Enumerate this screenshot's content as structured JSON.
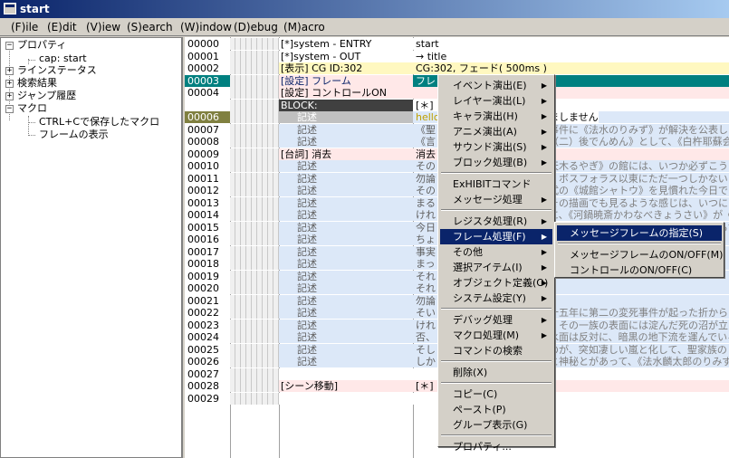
{
  "window": {
    "title": "start"
  },
  "menubar": [
    "(F)ile",
    "(E)dit",
    "(V)iew",
    "(S)earch",
    "(W)indow",
    "(D)ebug",
    "(M)acro"
  ],
  "tree": {
    "properties": "プロパティ",
    "cap": "cap: start",
    "line_status": "ラインステータス",
    "search_results": "検索結果",
    "jump_history": "ジャンプ履歴",
    "macro": "マクロ",
    "macro_items": [
      "CTRL+Cで保存したマクロ",
      "フレームの表示"
    ]
  },
  "rows": [
    {
      "num": "00000",
      "cmd": "[*]system -  ENTRY",
      "arg": "start"
    },
    {
      "num": "00001",
      "cmd": "[*]system -  OUT",
      "arg": "→ title"
    },
    {
      "num": "00002",
      "cmd": "[表示] CG ID:302",
      "arg": "CG:302, フェード( 500ms )"
    },
    {
      "num": "00003",
      "cmd": "[設定] フレーム",
      "arg": "フレ"
    },
    {
      "num": "00004",
      "cmd": "[設定] コントロールON",
      "arg": ""
    },
    {
      "num": "",
      "cmd": "BLOCK:",
      "arg": "[＊]"
    },
    {
      "num": "00006",
      "cmd": "記述",
      "arg": "hello"
    },
    {
      "num": "00007",
      "cmd": "記述",
      "arg": "《聖"
    },
    {
      "num": "00008",
      "cmd": "記述",
      "arg": "《言"
    },
    {
      "num": "00009",
      "cmd": "[台詞] 消去",
      "arg": "消去"
    },
    {
      "num": "00010",
      "cmd": "記述",
      "arg": "その"
    },
    {
      "num": "00011",
      "cmd": "記述",
      "arg": "勿論"
    },
    {
      "num": "00012",
      "cmd": "記述",
      "arg": "その"
    },
    {
      "num": "00013",
      "cmd": "記述",
      "arg": "まる"
    },
    {
      "num": "00014",
      "cmd": "記述",
      "arg": "けれ"
    },
    {
      "num": "00015",
      "cmd": "記述",
      "arg": "今日"
    },
    {
      "num": "00016",
      "cmd": "記述",
      "arg": "ちょ"
    },
    {
      "num": "00017",
      "cmd": "記述",
      "arg": "事実"
    },
    {
      "num": "00018",
      "cmd": "記述",
      "arg": "まっ"
    },
    {
      "num": "00019",
      "cmd": "記述",
      "arg": "それ"
    },
    {
      "num": "00020",
      "cmd": "記述",
      "arg": "それ"
    },
    {
      "num": "00021",
      "cmd": "記述",
      "arg": "勿論"
    },
    {
      "num": "00022",
      "cmd": "記述",
      "arg": "そい"
    },
    {
      "num": "00023",
      "cmd": "記述",
      "arg": "けれ"
    },
    {
      "num": "00024",
      "cmd": "記述",
      "arg": "否、"
    },
    {
      "num": "00025",
      "cmd": "記述",
      "arg": "そし"
    },
    {
      "num": "00026",
      "cmd": "記述",
      "arg": "しか"
    },
    {
      "num": "00027",
      "cmd": "",
      "arg": ""
    },
    {
      "num": "00028",
      "cmd": "[シーン移動]",
      "arg": "[＊]"
    },
    {
      "num": "00029",
      "cmd": "",
      "arg": ""
    }
  ],
  "right_text": [
    {
      "row": 6,
      "text": "ましません"
    },
    {
      "row": 7,
      "text": "事件に《法水のりみず》が解決を公表し"
    },
    {
      "row": 8,
      "text": "（二）後でんめん》として、《白杵耶蘇会神学"
    },
    {
      "row": 10,
      "text": "天木るやぎ》の館には、いつか必ずこう"
    },
    {
      "row": 11,
      "text": "、ボスフォラス以東にただ一つしかないと云"
    },
    {
      "row": 12,
      "text": "式の《城館シャトウ》を見慣れた今日で"
    },
    {
      "row": 13,
      "text": "その描画でも見るような感じは、いつになっ"
    },
    {
      "row": 14,
      "text": "に、《河鍋暁斎かわなべきょうさい》が《落"
    },
    {
      "row": 15,
      "text": "最初の惨劇が発生するまでは、それからずっと"
    },
    {
      "row": 22,
      "text": "十五年に第二の変死事件が起った折から"
    },
    {
      "row": 23,
      "text": "、その一族の表面には淀んだ死の沼が立ちな"
    },
    {
      "row": 24,
      "text": "水面は反対に、暗黒の地下流を運んでいる"
    },
    {
      "row": 25,
      "text": "のが、突如凄しい嵐と化して、聖家族の"
    },
    {
      "row": 26,
      "text": "と神秘とがあって、《法水麟太郎のりみず"
    }
  ],
  "context_menu": [
    {
      "label": "イベント演出(E)",
      "sub": true
    },
    {
      "label": "レイヤー演出(L)",
      "sub": true
    },
    {
      "label": "キャラ演出(H)",
      "sub": true
    },
    {
      "label": "アニメ演出(A)",
      "sub": true
    },
    {
      "label": "サウンド演出(S)",
      "sub": true
    },
    {
      "label": "ブロック処理(B)",
      "sub": true
    },
    {
      "sep": true
    },
    {
      "label": "ExHIBITコマンド",
      "sub": false
    },
    {
      "label": "メッセージ処理",
      "sub": true
    },
    {
      "sep": true
    },
    {
      "label": "レジスタ処理(R)",
      "sub": true
    },
    {
      "label": "フレーム処理(F)",
      "sub": true,
      "selected": true
    },
    {
      "label": "その他",
      "sub": true
    },
    {
      "label": "選択アイテム(I)",
      "sub": true
    },
    {
      "label": "オブジェクト定義(O)",
      "sub": true
    },
    {
      "label": "システム設定(Y)",
      "sub": true
    },
    {
      "sep": true
    },
    {
      "label": "デバッグ処理",
      "sub": true
    },
    {
      "label": "マクロ処理(M)",
      "sub": true
    },
    {
      "label": "コマンドの検索",
      "sub": false
    },
    {
      "sep": true
    },
    {
      "label": "削除(X)",
      "sub": false
    },
    {
      "sep": true
    },
    {
      "label": "コピー(C)",
      "sub": false
    },
    {
      "label": "ペースト(P)",
      "sub": false
    },
    {
      "label": "グループ表示(G)",
      "sub": false
    },
    {
      "sep": true
    },
    {
      "label": "プロパティ...",
      "sub": false
    }
  ],
  "submenu": [
    {
      "label": "メッセージフレームの指定(S)",
      "selected": true
    },
    {
      "sep": true
    },
    {
      "label": "メッセージフレームのON/OFF(M)"
    },
    {
      "label": "コントロールのON/OFF(C)"
    }
  ],
  "colors": {
    "highlight": "#0a246a",
    "selected_row": "#008080"
  }
}
